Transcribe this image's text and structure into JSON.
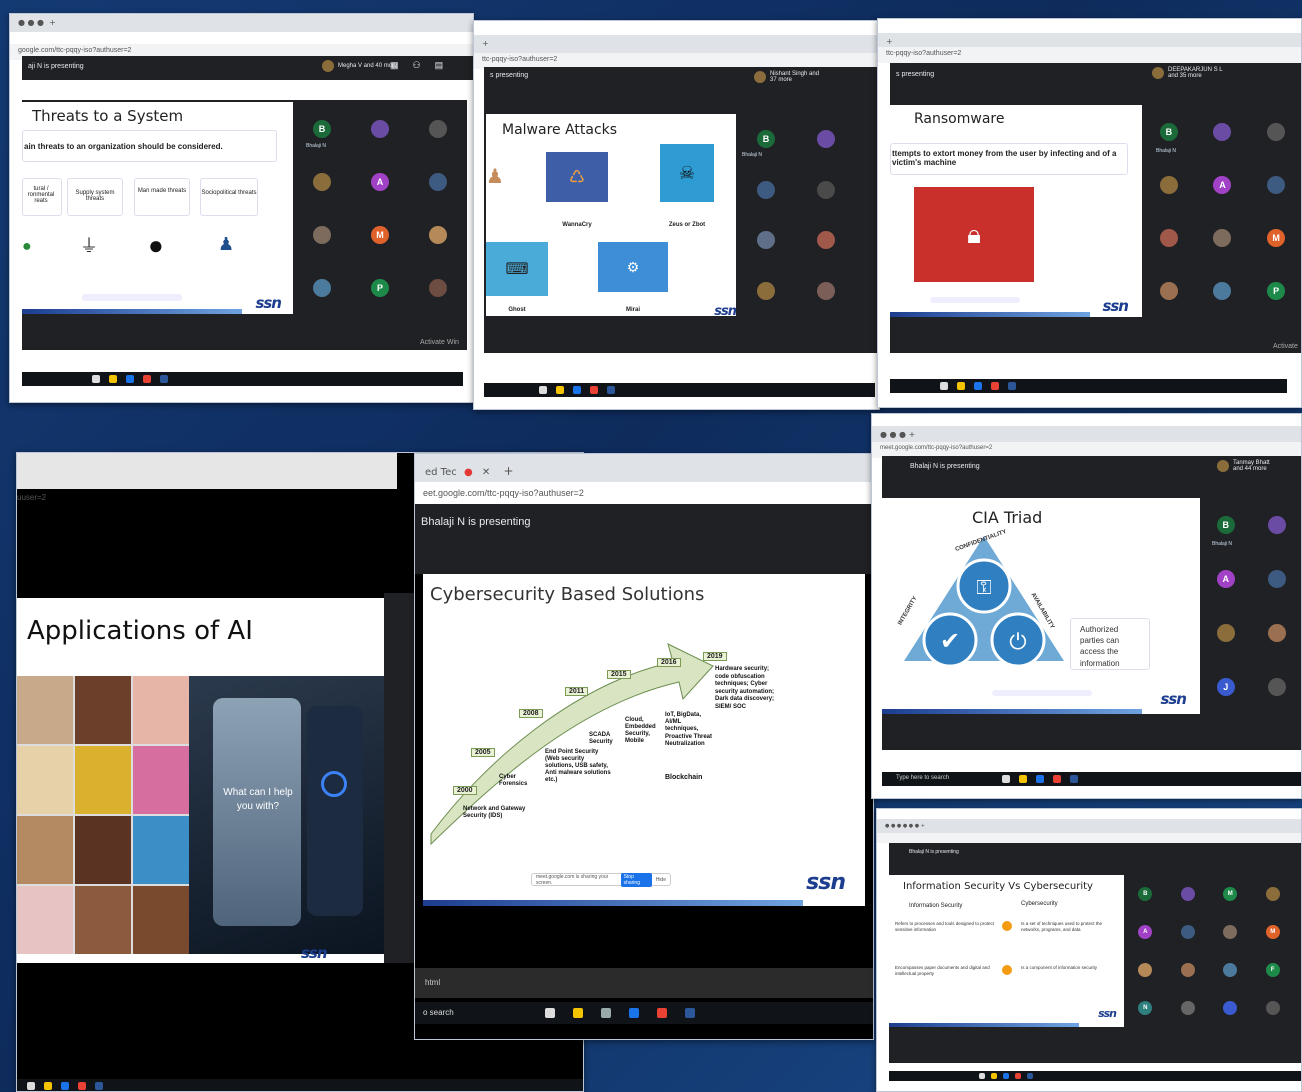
{
  "s1": {
    "presenting": "aji N is presenting",
    "url": "google.com/ttc-pqqy-iso?authuser=2",
    "meet": "Megha V and 40 more",
    "title": "Threats to a System",
    "subtitle": "ain threats to an organization should be considered.",
    "cards": [
      "tural / ronmental reats",
      "Supply system threats",
      "Man made threats",
      "Sociopolitical threats"
    ],
    "speaker": "Bhalaji N",
    "activate": "Activate Win"
  },
  "s2": {
    "url": "ttc-pqqy-iso?authuser=2",
    "presenting": "s presenting",
    "meet": "Nishant Singh and 37 more",
    "title": "Malware Attacks",
    "labels": [
      "WannaCry",
      "Zeus or Zbot",
      "Ghost",
      "Mirai"
    ],
    "speaker": "Bhalaji N"
  },
  "s3": {
    "url": "ttc-pqqy-iso?authuser=2",
    "presenting": "s presenting",
    "meet": "DEEPAKARJUN S L and 35 more",
    "title": "Ransomware",
    "subtitle": "ttempts to extort money from the user by infecting and of a victim's machine",
    "speaker": "Bhalaji N",
    "activate": "Activate"
  },
  "s4": {
    "url": "uuser=2",
    "title": "Applications of AI",
    "phone_text": "What can I help you with?"
  },
  "s5": {
    "tab": "ed Tec",
    "url": "eet.google.com/ttc-pqqy-iso?authuser=2",
    "presenting": "Bhalaji N is presenting",
    "title": "Cybersecurity Based Solutions",
    "years": [
      "2000",
      "2005",
      "2008",
      "2011",
      "2015",
      "2016",
      "2019"
    ],
    "items": [
      "Network and Gateway Security (IDS)",
      "Cyber Forensics",
      "End Point Security (Web security solutions, USB safety, Anti malware solutions etc.)",
      "SCADA Security",
      "Cloud, Embedded Security, Mobile",
      "IoT, BigData, AI/ML techniques, Proactive Threat Neutralization",
      "Blockchain",
      "Hardware security; code obfuscation techniques; Cyber security automation; Dark data discovery; SIEM/ SOC"
    ],
    "footer": "meet.google.com is sharing your screen.",
    "stop": "Stop sharing",
    "hide": "Hide",
    "bottom": "html",
    "search": "o search"
  },
  "s6": {
    "url": "meet.google.com/ttc-pqqy-iso?authuser=2",
    "presenting": "Bhalaji N is presenting",
    "meet": "Tanmay Bhatt and 44 more",
    "title": "CIA Triad",
    "labels": [
      "CONFIDENTIALITY",
      "INTEGRITY",
      "AVAILABILITY"
    ],
    "note": "Authorized parties can access the information",
    "speaker": "Bhalaji N",
    "search": "Type here to search"
  },
  "s7": {
    "title": "Information Security Vs Cybersecurity",
    "col1": "Information Security",
    "col2": "Cybersecurity",
    "rows": [
      [
        "Refers to processes and tools designed to protect sensitive information",
        "Is a set of techniques used to protect the networks, programs, and data"
      ],
      [
        "Encompasses paper documents and digital and intellectual property",
        "Is a component of information security"
      ]
    ],
    "presenting": "Bhalaji N is presenting"
  }
}
